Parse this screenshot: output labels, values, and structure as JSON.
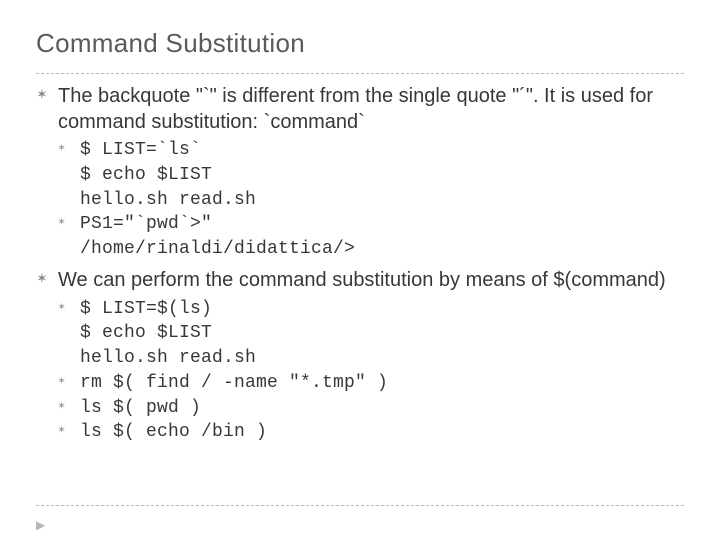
{
  "title": "Command Substitution",
  "body": {
    "p1": "The backquote \"`\" is different from the single quote \"´\". It is used for command substitution: `command`",
    "code1": {
      "l1": "$ LIST=`ls`",
      "l2": "$ echo $LIST",
      "l3": "hello.sh read.sh",
      "l4": "PS1=\"`pwd`>\"",
      "l5": "/home/rinaldi/didattica/>"
    },
    "p2": "We can perform the command substitution by means of $(command)",
    "code2": {
      "l1": "$ LIST=$(ls)",
      "l2": "$ echo $LIST",
      "l3": "hello.sh read.sh",
      "l4": "rm $( find / -name \"*.tmp\" )",
      "l5": "ls $( pwd )",
      "l6": "ls $( echo /bin )"
    }
  },
  "footer_arrow": "▶"
}
